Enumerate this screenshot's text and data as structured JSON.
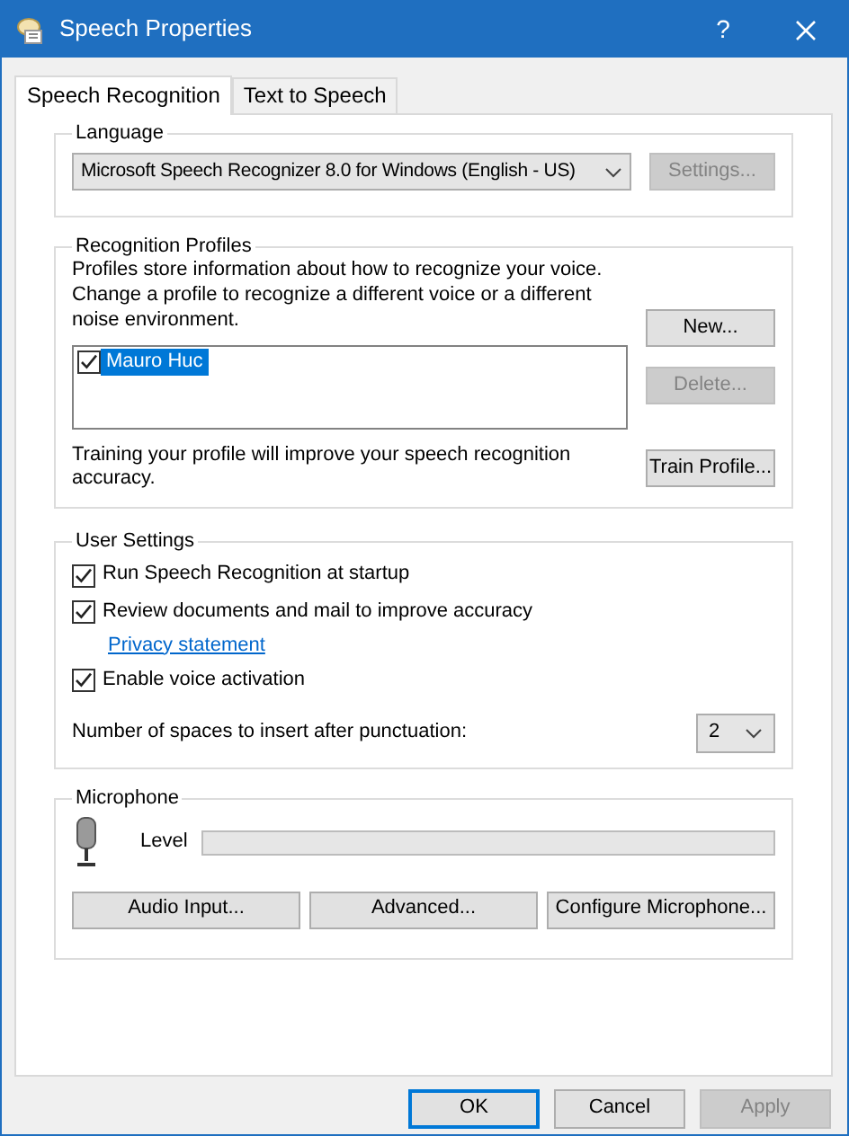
{
  "window": {
    "title": "Speech Properties",
    "help": "?"
  },
  "tabs": [
    {
      "label": "Speech Recognition",
      "selected": true
    },
    {
      "label": "Text to Speech",
      "selected": false
    }
  ],
  "language": {
    "legend": "Language",
    "recognizer": "Microsoft Speech Recognizer 8.0 for Windows (English - US)",
    "settings_button": {
      "label": "Settings...",
      "disabled": true
    }
  },
  "recognition_profiles": {
    "legend": "Recognition Profiles",
    "description": "Profiles store information about how to recognize your voice. Change a profile to recognize a different voice or a different noise environment.",
    "profiles": [
      {
        "name": "Mauro Huc",
        "checked": true,
        "selected": true
      }
    ],
    "new_button": {
      "label": "New...",
      "disabled": false
    },
    "delete_button": {
      "label": "Delete...",
      "disabled": true
    },
    "training_text": "Training your profile will improve your speech recognition accuracy.",
    "train_button": {
      "label": "Train Profile...",
      "disabled": false
    }
  },
  "user_settings": {
    "legend": "User Settings",
    "options": [
      {
        "kind": "checkbox",
        "label": "Run Speech Recognition at startup",
        "checked": true
      },
      {
        "kind": "checkbox",
        "label": "Review documents and mail to improve accuracy",
        "checked": true
      },
      {
        "kind": "link",
        "label": "Privacy statement"
      },
      {
        "kind": "checkbox",
        "label": "Enable voice activation",
        "checked": true
      }
    ],
    "spaces_label": "Number of spaces to insert after punctuation:",
    "spaces_value": "2"
  },
  "microphone": {
    "legend": "Microphone",
    "level_label": "Level",
    "level": 0,
    "buttons": [
      {
        "label": "Audio Input...",
        "disabled": false
      },
      {
        "label": "Advanced...",
        "disabled": false
      },
      {
        "label": "Configure Microphone...",
        "disabled": false
      }
    ]
  },
  "dialog_buttons": [
    {
      "label": "OK",
      "default": true,
      "disabled": false
    },
    {
      "label": "Cancel",
      "default": false,
      "disabled": false
    },
    {
      "label": "Apply",
      "default": false,
      "disabled": true
    }
  ]
}
